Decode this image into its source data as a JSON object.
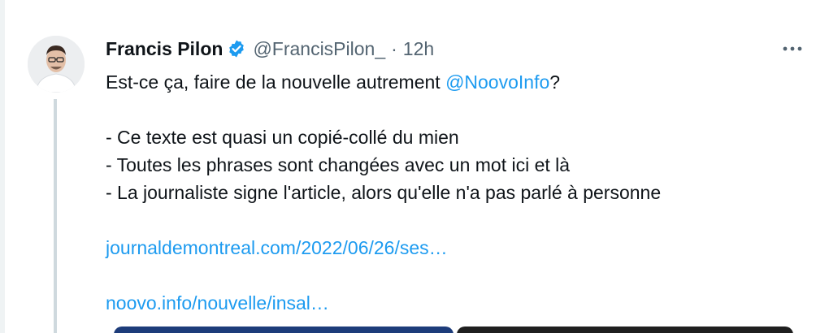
{
  "tweet": {
    "display_name": "Francis Pilon",
    "handle": "@FrancisPilon_",
    "separator": "·",
    "time": "12h",
    "icons": {
      "verified": "verified-badge-icon",
      "more": "more-options-icon"
    },
    "text": {
      "line1_prefix": "Est-ce ça, faire de la nouvelle autrement ",
      "line1_mention": "@NoovoInfo",
      "line1_suffix": "?",
      "bullets": [
        "- Ce texte est quasi un copié-collé du mien",
        "- Toutes les phrases sont changées avec un mot ici et là",
        "- La journaliste signe l'article, alors qu'elle n'a pas parlé à personne"
      ],
      "link1": "journaldemontreal.com/2022/06/26/ses…",
      "link2": "noovo.info/nouvelle/insal…"
    }
  },
  "colors": {
    "accent": "#1d9bf0",
    "text": "#0f1419",
    "muted": "#536471",
    "thread_line": "#cfd9de"
  }
}
